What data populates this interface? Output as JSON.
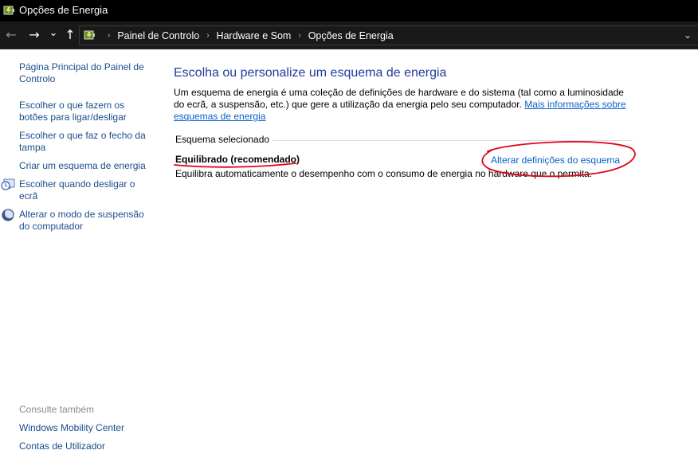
{
  "window": {
    "title": "Opções de Energia",
    "icon": "power-options-icon"
  },
  "nav": {
    "back_icon": "arrow-left-icon",
    "forward_icon": "arrow-right-icon",
    "recent_icon": "chevron-down-icon",
    "up_icon": "arrow-up-icon",
    "back_glyph": "←",
    "forward_glyph": "→",
    "recent_glyph": "⌄",
    "up_glyph": "↑",
    "dropdown_glyph": "⌄"
  },
  "address": {
    "separator": "›",
    "crumbs": [
      "Painel de Controlo",
      "Hardware e Som",
      "Opções de Energia"
    ]
  },
  "sidebar": {
    "items": [
      {
        "label": "Página Principal do Painel de Controlo",
        "icon": ""
      },
      {
        "label": "Escolher o que fazem os botões para ligar/desligar",
        "icon": ""
      },
      {
        "label": "Escolher o que faz o fecho da tampa",
        "icon": ""
      },
      {
        "label": "Criar um esquema de energia",
        "icon": ""
      },
      {
        "label": "Escolher quando desligar o ecrã",
        "icon": "display-clock-icon"
      },
      {
        "label": "Alterar o modo de suspensão do computador",
        "icon": "moon-icon"
      }
    ],
    "see_also_label": "Consulte também",
    "see_also": [
      {
        "label": "Windows Mobility Center"
      },
      {
        "label": "Contas de Utilizador"
      }
    ]
  },
  "main": {
    "title": "Escolha ou personalize um esquema de energia",
    "description": "Um esquema de energia é uma coleção de definições de hardware e do sistema (tal como a luminosidade do ecrã, a suspensão, etc.) que gere a utilização da energia pelo seu computador.",
    "more_info_link": "Mais informações sobre esquemas de energia",
    "selected_heading": "Esquema selecionado",
    "plan": {
      "name": "Equilibrado (recomendado)",
      "change_link": "Alterar definições do esquema",
      "description": "Equilibra automaticamente o desempenho com o consumo de energia no hardware que o permita."
    }
  },
  "colors": {
    "link": "#0b62c4",
    "title": "#1e3f9a",
    "annotation": "#e3001b",
    "titlebar": "#000000"
  }
}
